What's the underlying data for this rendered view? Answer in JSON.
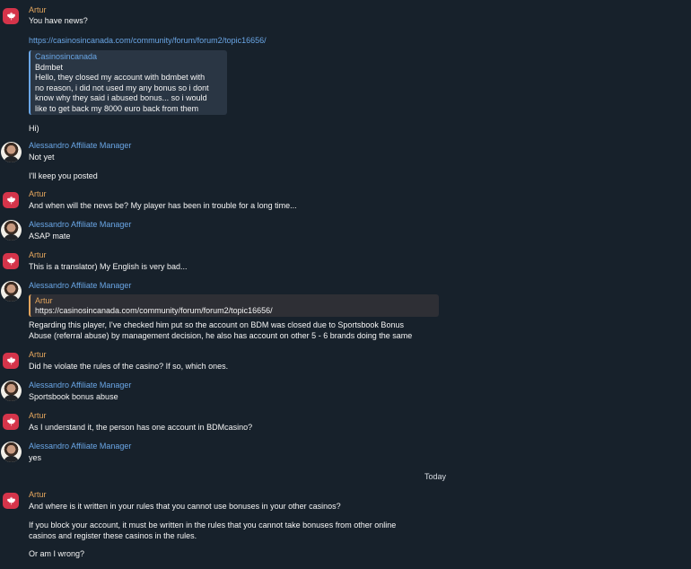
{
  "people": {
    "artur": "Artur",
    "alessandro": "Alessandro Affiliate Manager"
  },
  "colors": {
    "background": "#17212b",
    "artur_name": "#e3a55d",
    "alessandro_name": "#6aa6e6",
    "maple_avatar": "#d5344a",
    "quote_bg": "#2a3644"
  },
  "icons": {
    "artur_avatar": "maple-leaf-icon",
    "alessandro_avatar": "profile-photo"
  },
  "messages": {
    "m1_text": "You have news?",
    "m1_link": "https://casinosincanada.com/community/forum/forum2/topic16656/",
    "m1_preview": {
      "site": "Casinosincanada",
      "title": "Bdmbet",
      "lines": [
        "Hello, they closed my account with bdmbet with",
        "no reason, i did not used my any bonus so i dont",
        "know why they said i abused bonus... so i would",
        "like to get back my 8000 euro back from them"
      ]
    },
    "m1_hi": "Hi)",
    "m2_text": "Not yet",
    "m2_text2": "I'll keep you posted",
    "m3_text": "And when will the news be? My player has been in trouble for a long time...",
    "m4_text": "ASAP mate",
    "m5_text": "This is a translator) My English is very bad...",
    "m6_reply_name": "Artur",
    "m6_reply_text": "https://casinosincanada.com/community/forum/forum2/topic16656/",
    "m6_line1": "Regarding this player, I've checked him put so the account on BDM was closed due to Sportsbook Bonus",
    "m6_line2": "Abuse (referral abuse) by management decision, he also has account on other 5 - 6 brands doing the same",
    "m7_text": "Did he violate the rules of the casino? If so, which ones.",
    "m8_text": "Sportsbook bonus abuse",
    "m9_text": "As I understand it, the person has one account in BDMcasino?",
    "m10_text": "yes",
    "date_separator": "Today",
    "m11_line1": "And where is it written in your rules that you cannot use bonuses in your other casinos?",
    "m11_line2": "If you block your account, it must be written in the rules that you cannot take bonuses from other online",
    "m11_line3": "casinos and register these casinos in the rules.",
    "m11_line4": "Or am I wrong?"
  }
}
